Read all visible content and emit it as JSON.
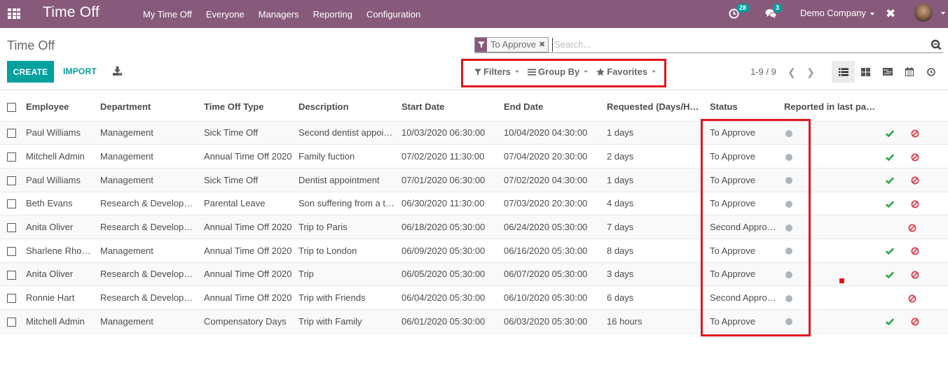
{
  "navbar": {
    "app_title": "Time Off",
    "menu": [
      "My Time Off",
      "Everyone",
      "Managers",
      "Reporting",
      "Configuration"
    ],
    "activity_count": "28",
    "message_count": "3",
    "company": "Demo Company"
  },
  "control_panel": {
    "breadcrumb": "Time Off",
    "facet_label": "To Approve",
    "search_placeholder": "Search...",
    "create_label": "CREATE",
    "import_label": "IMPORT",
    "filters_label": "Filters",
    "groupby_label": "Group By",
    "favorites_label": "Favorites",
    "pager_value": "1-9 / 9",
    "views": [
      "list",
      "kanban",
      "gantt",
      "calendar",
      "activity"
    ],
    "active_view": "list"
  },
  "table": {
    "headers": [
      "Employee",
      "Department",
      "Time Off Type",
      "Description",
      "Start Date",
      "End Date",
      "Requested (Days/Hou…",
      "Status",
      "Reported in last pay…"
    ],
    "rows": [
      {
        "employee": "Paul Williams",
        "department": "Management",
        "type": "Sick Time Off",
        "description": "Second dentist appoin…",
        "start": "10/03/2020 06:30:00",
        "end": "10/04/2020 04:30:00",
        "requested": "1 days",
        "status": "To Approve"
      },
      {
        "employee": "Mitchell Admin",
        "department": "Management",
        "type": "Annual Time Off 2020",
        "description": "Family fuction",
        "start": "07/02/2020 11:30:00",
        "end": "07/04/2020 20:30:00",
        "requested": "2 days",
        "status": "To Approve"
      },
      {
        "employee": "Paul Williams",
        "department": "Management",
        "type": "Sick Time Off",
        "description": "Dentist appointment",
        "start": "07/01/2020 06:30:00",
        "end": "07/02/2020 04:30:00",
        "requested": "1 days",
        "status": "To Approve"
      },
      {
        "employee": "Beth Evans",
        "department": "Research & Developm…",
        "type": "Parental Leave",
        "description": "Son suffering from a t…",
        "start": "06/30/2020 11:30:00",
        "end": "07/03/2020 20:30:00",
        "requested": "4 days",
        "status": "To Approve"
      },
      {
        "employee": "Anita Oliver",
        "department": "Research & Developm…",
        "type": "Annual Time Off 2020",
        "description": "Trip to Paris",
        "start": "06/18/2020 05:30:00",
        "end": "06/24/2020 05:30:00",
        "requested": "7 days",
        "status": "Second Approval"
      },
      {
        "employee": "Sharlene Rhodes",
        "department": "Management",
        "type": "Annual Time Off 2020",
        "description": "Trip to London",
        "start": "06/09/2020 05:30:00",
        "end": "06/16/2020 05:30:00",
        "requested": "8 days",
        "status": "To Approve"
      },
      {
        "employee": "Anita Oliver",
        "department": "Research & Developm…",
        "type": "Annual Time Off 2020",
        "description": "Trip",
        "start": "06/05/2020 05:30:00",
        "end": "06/07/2020 05:30:00",
        "requested": "3 days",
        "status": "To Approve"
      },
      {
        "employee": "Ronnie Hart",
        "department": "Research & Developm…",
        "type": "Annual Time Off 2020",
        "description": "Trip with Friends",
        "start": "06/04/2020 05:30:00",
        "end": "06/10/2020 05:30:00",
        "requested": "6 days",
        "status": "Second Approval"
      },
      {
        "employee": "Mitchell Admin",
        "department": "Management",
        "type": "Compensatory Days",
        "description": "Trip with Family",
        "start": "06/01/2020 05:30:00",
        "end": "06/03/2020 05:30:00",
        "requested": "16 hours",
        "status": "To Approve"
      }
    ]
  },
  "colors": {
    "brand": "#875a7b",
    "primary": "#00a09d",
    "approve": "#28a745",
    "refuse": "#dc3545",
    "highlight": "#e0161d",
    "report_dot": "#adb5bd"
  }
}
